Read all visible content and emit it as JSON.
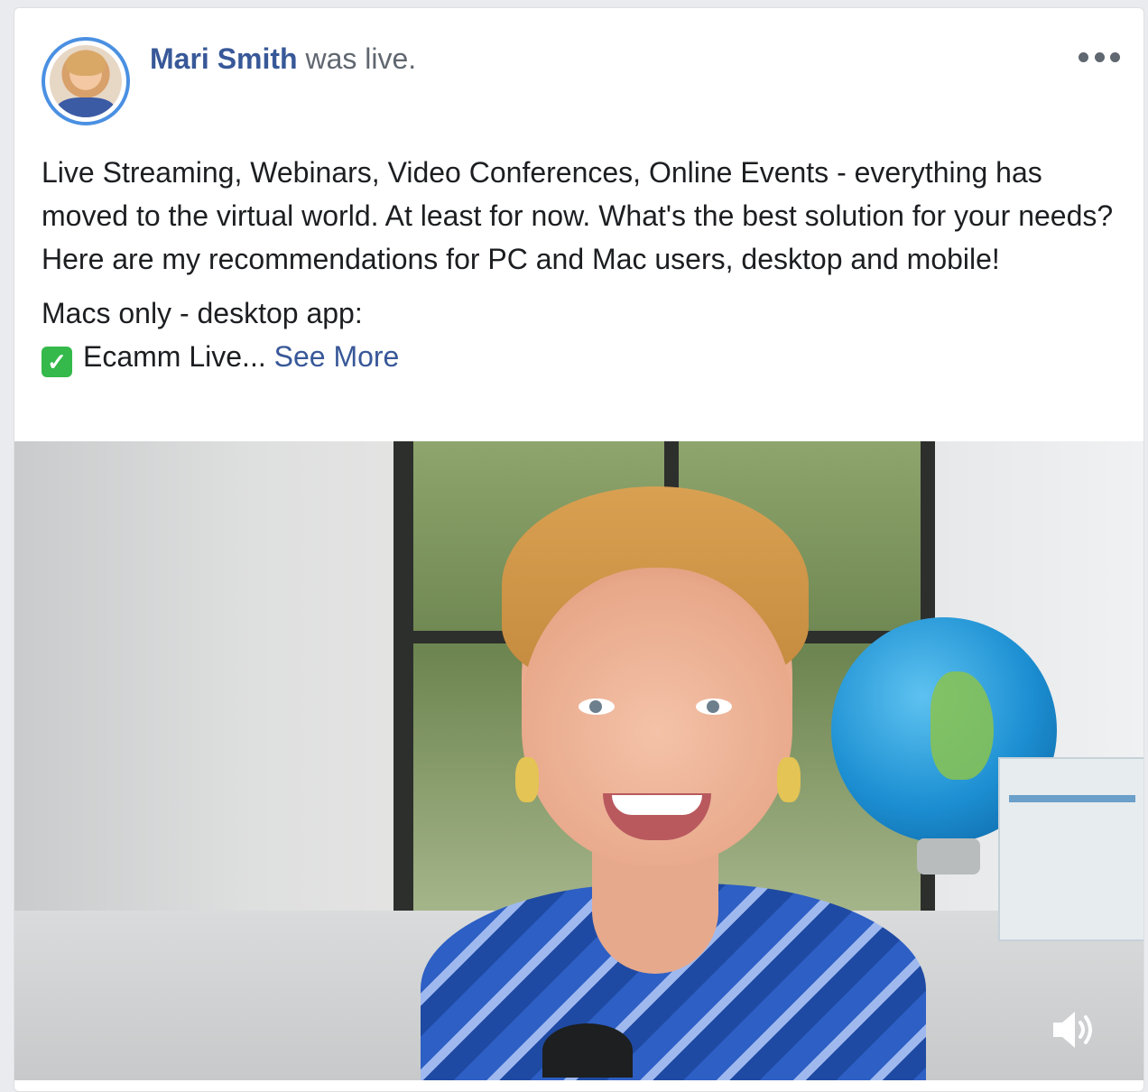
{
  "post": {
    "author": "Mari Smith",
    "status_text": " was live.",
    "more_icon": "more-dots-icon",
    "text": {
      "paragraph1": "Live Streaming, Webinars, Video Conferences, Online Events - everything has moved to the virtual world. At least for now. What's the best solution for your needs? Here are my recommendations for PC and Mac users, desktop and mobile!",
      "line2": "Macs only - desktop app:",
      "line3_check": "✓",
      "line3": "Ecamm Live... ",
      "see_more": "See More"
    },
    "video": {
      "volume_icon": "speaker-icon"
    }
  },
  "colors": {
    "link": "#385898",
    "avatar_ring": "#4a90e2",
    "check_green": "#34b94a",
    "text": "#1c1e21",
    "muted": "#606770"
  }
}
